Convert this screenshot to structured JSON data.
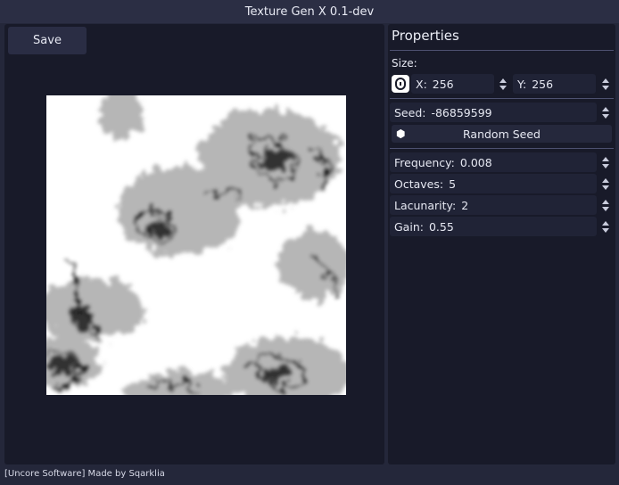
{
  "window": {
    "title": "Texture Gen X 0.1-dev"
  },
  "toolbar": {
    "save_label": "Save"
  },
  "properties": {
    "title": "Properties",
    "size_label": "Size:",
    "x": {
      "label": "X:",
      "value": "256"
    },
    "y": {
      "label": "Y:",
      "value": "256"
    },
    "seed": {
      "label": "Seed:",
      "value": "-86859599"
    },
    "random_seed_label": "Random Seed",
    "frequency": {
      "label": "Frequency:",
      "value": "0.008"
    },
    "octaves": {
      "label": "Octaves:",
      "value": "5"
    },
    "lacunarity": {
      "label": "Lacunarity:",
      "value": "2"
    },
    "gain": {
      "label": "Gain:",
      "value": "0.55"
    }
  },
  "footer": {
    "text": "[Uncore Software] Made by Sqarklia"
  },
  "icons": {
    "link": "link-toggle-icon",
    "dice": "dice-icon",
    "spin": "spinner-arrows-icon"
  },
  "colors": {
    "background": "#24273a",
    "panel": "#181a29",
    "field": "#202336",
    "button": "#2a2d44"
  }
}
